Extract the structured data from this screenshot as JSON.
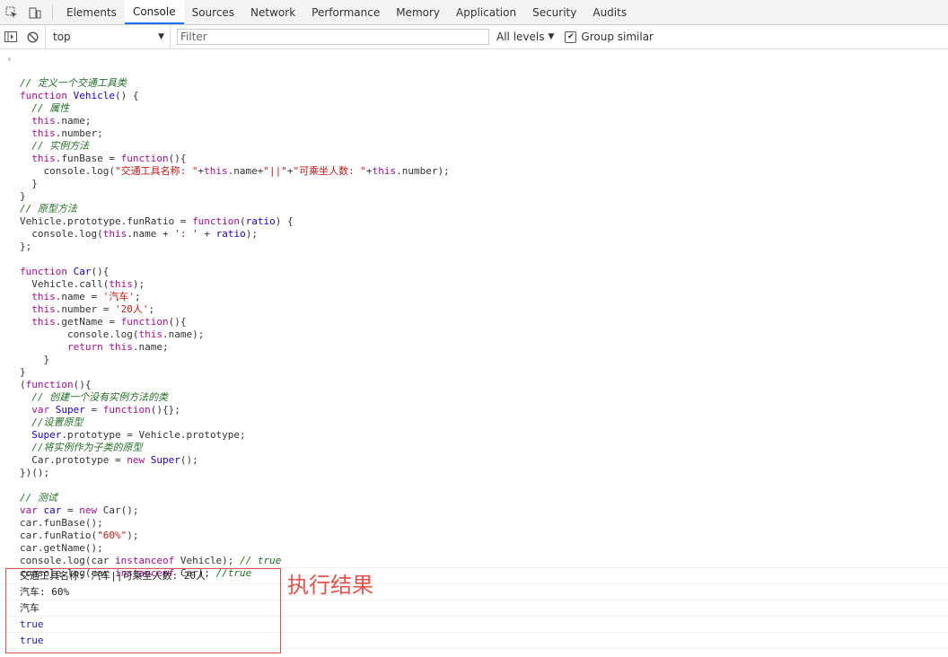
{
  "tabs": [
    "Elements",
    "Console",
    "Sources",
    "Network",
    "Performance",
    "Memory",
    "Application",
    "Security",
    "Audits"
  ],
  "active_tab": "Console",
  "toolbar": {
    "context": "top",
    "filter_placeholder": "Filter",
    "levels_label": "All levels",
    "group_similar_label": "Group similar",
    "group_similar_checked": true
  },
  "code": [
    [
      [
        "cm",
        "// 定义一个交通工具类"
      ]
    ],
    [
      [
        "kw",
        "function "
      ],
      [
        "fn",
        "Vehicle"
      ],
      [
        "tk",
        "() {"
      ]
    ],
    [
      [
        "tk",
        "  "
      ],
      [
        "cm",
        "// 属性"
      ]
    ],
    [
      [
        "tk",
        "  "
      ],
      [
        "kw",
        "this"
      ],
      [
        "tk",
        ".name;"
      ]
    ],
    [
      [
        "tk",
        "  "
      ],
      [
        "kw",
        "this"
      ],
      [
        "tk",
        ".number;"
      ]
    ],
    [
      [
        "tk",
        "  "
      ],
      [
        "cm",
        "// 实例方法"
      ]
    ],
    [
      [
        "tk",
        "  "
      ],
      [
        "kw",
        "this"
      ],
      [
        "tk",
        ".funBase = "
      ],
      [
        "kw",
        "function"
      ],
      [
        "tk",
        "(){"
      ]
    ],
    [
      [
        "tk",
        "    console.log("
      ],
      [
        "st",
        "\"交通工具名称: \""
      ],
      [
        "tk",
        "+"
      ],
      [
        "kw",
        "this"
      ],
      [
        "tk",
        ".name+"
      ],
      [
        "st",
        "\"||\""
      ],
      [
        "tk",
        "+"
      ],
      [
        "st",
        "\"可乘坐人数: \""
      ],
      [
        "tk",
        "+"
      ],
      [
        "kw",
        "this"
      ],
      [
        "tk",
        ".number);"
      ]
    ],
    [
      [
        "tk",
        "  }"
      ]
    ],
    [
      [
        "tk",
        "}"
      ]
    ],
    [
      [
        "cm",
        "// 原型方法"
      ]
    ],
    [
      [
        "tk",
        "Vehicle.prototype.funRatio = "
      ],
      [
        "kw",
        "function"
      ],
      [
        "tk",
        "("
      ],
      [
        "fn",
        "ratio"
      ],
      [
        "tk",
        ") {"
      ]
    ],
    [
      [
        "tk",
        "  console.log("
      ],
      [
        "kw",
        "this"
      ],
      [
        "tk",
        ".name + "
      ],
      [
        "st",
        "': '"
      ],
      [
        "tk",
        " + "
      ],
      [
        "fn",
        "ratio"
      ],
      [
        "tk",
        ");"
      ]
    ],
    [
      [
        "tk",
        "};"
      ]
    ],
    [
      [
        "tk",
        ""
      ]
    ],
    [
      [
        "kw",
        "function "
      ],
      [
        "fn",
        "Car"
      ],
      [
        "tk",
        "(){"
      ]
    ],
    [
      [
        "tk",
        "  Vehicle.call("
      ],
      [
        "kw",
        "this"
      ],
      [
        "tk",
        ");"
      ]
    ],
    [
      [
        "tk",
        "  "
      ],
      [
        "kw",
        "this"
      ],
      [
        "tk",
        ".name = "
      ],
      [
        "st",
        "'汽车'"
      ],
      [
        "tk",
        ";"
      ]
    ],
    [
      [
        "tk",
        "  "
      ],
      [
        "kw",
        "this"
      ],
      [
        "tk",
        ".number = "
      ],
      [
        "st",
        "'20人'"
      ],
      [
        "tk",
        ";"
      ]
    ],
    [
      [
        "tk",
        "  "
      ],
      [
        "kw",
        "this"
      ],
      [
        "tk",
        ".getName = "
      ],
      [
        "kw",
        "function"
      ],
      [
        "tk",
        "(){"
      ]
    ],
    [
      [
        "tk",
        "        console.log("
      ],
      [
        "kw",
        "this"
      ],
      [
        "tk",
        ".name);"
      ]
    ],
    [
      [
        "tk",
        "        "
      ],
      [
        "kw",
        "return "
      ],
      [
        "kw",
        "this"
      ],
      [
        "tk",
        ".name;"
      ]
    ],
    [
      [
        "tk",
        "    }"
      ]
    ],
    [
      [
        "tk",
        "}"
      ]
    ],
    [
      [
        "tk",
        "("
      ],
      [
        "kw",
        "function"
      ],
      [
        "tk",
        "(){"
      ]
    ],
    [
      [
        "tk",
        "  "
      ],
      [
        "cm",
        "// 创建一个没有实例方法的类"
      ]
    ],
    [
      [
        "tk",
        "  "
      ],
      [
        "kw",
        "var "
      ],
      [
        "fn",
        "Super"
      ],
      [
        "tk",
        " = "
      ],
      [
        "kw",
        "function"
      ],
      [
        "tk",
        "(){};"
      ]
    ],
    [
      [
        "tk",
        "  "
      ],
      [
        "cm",
        "//设置原型"
      ]
    ],
    [
      [
        "tk",
        "  "
      ],
      [
        "fn",
        "Super"
      ],
      [
        "tk",
        ".prototype = Vehicle.prototype;"
      ]
    ],
    [
      [
        "tk",
        "  "
      ],
      [
        "cm",
        "//将实例作为子类的原型"
      ]
    ],
    [
      [
        "tk",
        "  Car.prototype = "
      ],
      [
        "kw",
        "new "
      ],
      [
        "fn",
        "Super"
      ],
      [
        "tk",
        "();"
      ]
    ],
    [
      [
        "tk",
        "})();"
      ]
    ],
    [
      [
        "tk",
        ""
      ]
    ],
    [
      [
        "tk",
        ""
      ],
      [
        "cm",
        "// 测试"
      ]
    ],
    [
      [
        "kw",
        "var "
      ],
      [
        "fn",
        "car"
      ],
      [
        "tk",
        " = "
      ],
      [
        "kw",
        "new "
      ],
      [
        "tk",
        "Car();"
      ]
    ],
    [
      [
        "tk",
        "car.funBase();"
      ]
    ],
    [
      [
        "tk",
        "car.funRatio("
      ],
      [
        "st",
        "\"60%\""
      ],
      [
        "tk",
        ");"
      ]
    ],
    [
      [
        "tk",
        "car.getName();"
      ]
    ],
    [
      [
        "tk",
        "console.log(car "
      ],
      [
        "kw",
        "instanceof"
      ],
      [
        "tk",
        " Vehicle); "
      ],
      [
        "cm",
        "// true"
      ]
    ],
    [
      [
        "tk",
        "console.log(car "
      ],
      [
        "kw",
        "instanceof"
      ],
      [
        "tk",
        " Car); "
      ],
      [
        "cm",
        "//true"
      ]
    ]
  ],
  "output": [
    {
      "text": "交通工具名称: 汽车||可乘坐人数: 20人",
      "bool": false
    },
    {
      "text": "汽车: 60%",
      "bool": false
    },
    {
      "text": "汽车",
      "bool": false
    },
    {
      "text": "true",
      "bool": true
    },
    {
      "text": "true",
      "bool": true
    }
  ],
  "annotation": "执行结果",
  "colors": {
    "accent": "#1a73e8",
    "annotation": "#e4534b",
    "keyword": "#aa0d91",
    "comment": "#236e25",
    "string": "#c41a16"
  }
}
